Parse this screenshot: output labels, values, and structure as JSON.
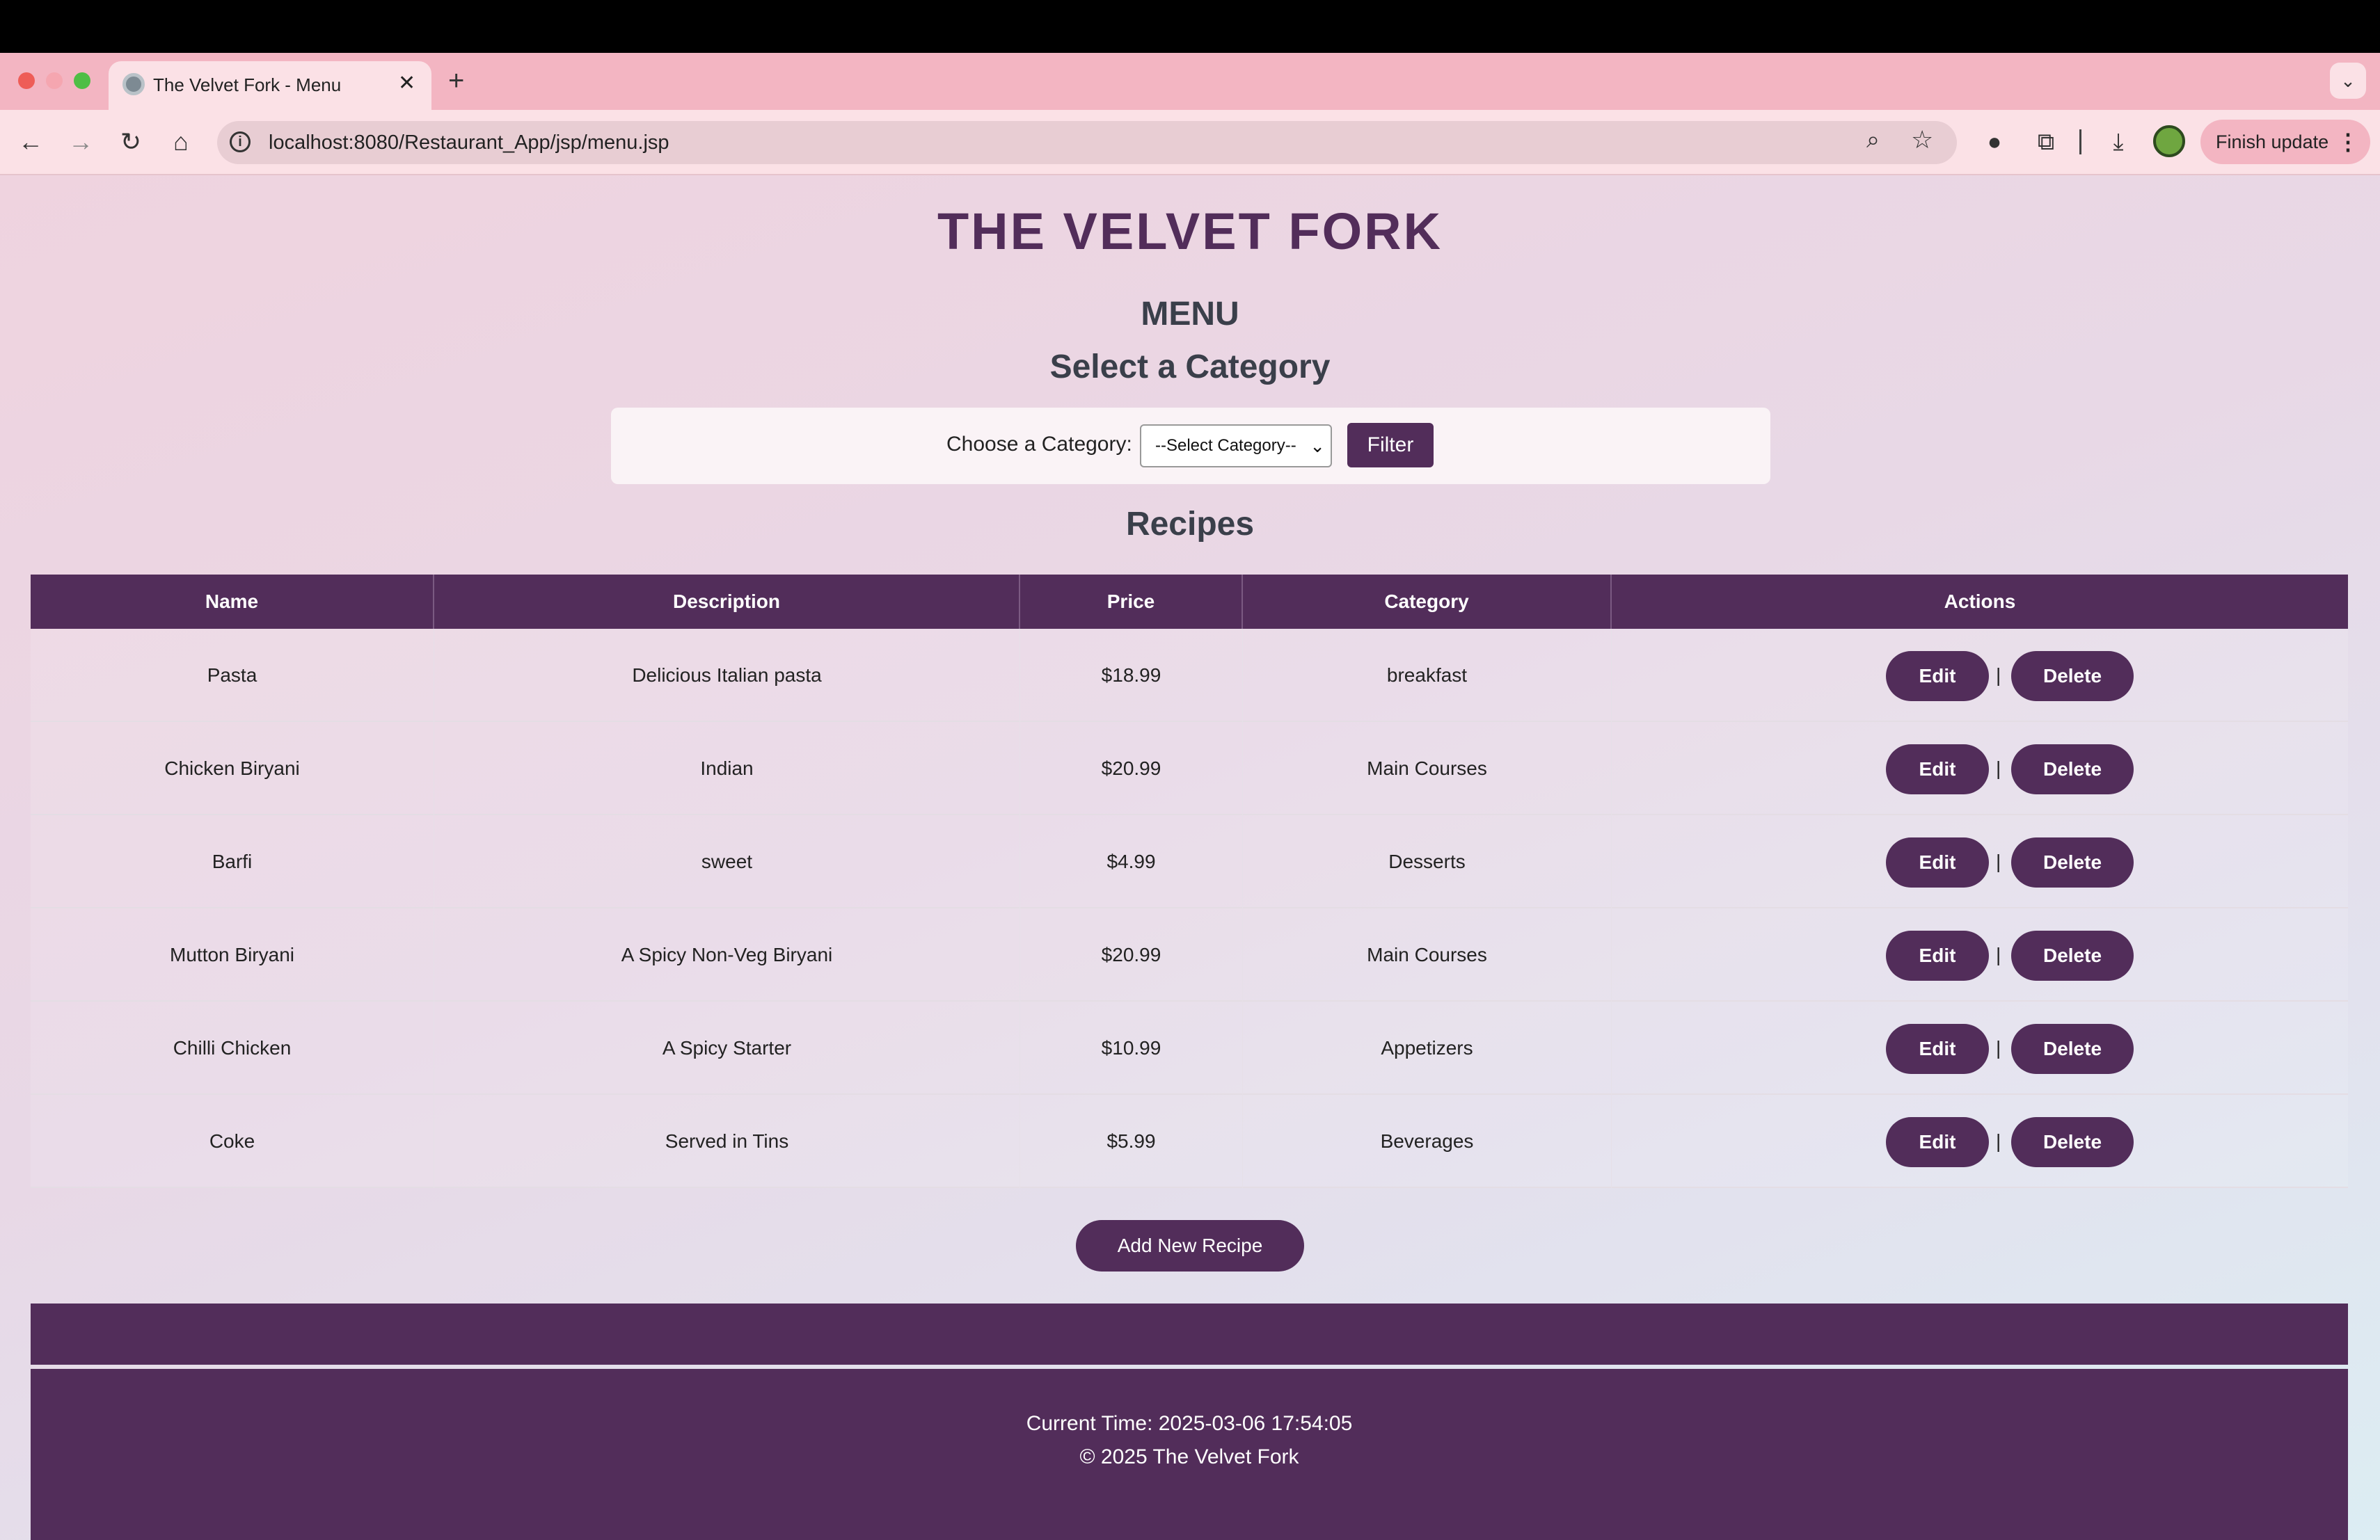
{
  "browser": {
    "tab_title": "The Velvet Fork - Menu",
    "tab_close": "✕",
    "new_tab": "+",
    "url": "localhost:8080/Restaurant_App/jsp/menu.jsp",
    "finish_update": "Finish update"
  },
  "page": {
    "site_title": "THE VELVET FORK",
    "menu_heading": "MENU",
    "category_heading": "Select a Category",
    "filter": {
      "label": "Choose a Category:",
      "selected": "--Select Category--",
      "button": "Filter"
    },
    "recipes_heading": "Recipes",
    "table": {
      "headers": [
        "Name",
        "Description",
        "Price",
        "Category",
        "Actions"
      ],
      "rows": [
        {
          "name": "Pasta",
          "description": "Delicious Italian pasta",
          "price": "$18.99",
          "category": "breakfast"
        },
        {
          "name": "Chicken Biryani",
          "description": "Indian",
          "price": "$20.99",
          "category": "Main Courses"
        },
        {
          "name": "Barfi",
          "description": "sweet",
          "price": "$4.99",
          "category": "Desserts"
        },
        {
          "name": "Mutton Biryani",
          "description": "A Spicy Non-Veg Biryani",
          "price": "$20.99",
          "category": "Main Courses"
        },
        {
          "name": "Chilli Chicken",
          "description": "A Spicy Starter",
          "price": "$10.99",
          "category": "Appetizers"
        },
        {
          "name": "Coke",
          "description": "Served in Tins",
          "price": "$5.99",
          "category": "Beverages"
        }
      ],
      "edit_label": "Edit",
      "separator": "|",
      "delete_label": "Delete"
    },
    "add_button": "Add New Recipe",
    "footer": {
      "current_time": "Current Time: 2025-03-06 17:54:05",
      "copyright": "© 2025 The Velvet Fork"
    }
  },
  "colors": {
    "brand": "#522d5a",
    "tab_strip": "#f3b5c2",
    "heading": "#3a3f4a"
  }
}
